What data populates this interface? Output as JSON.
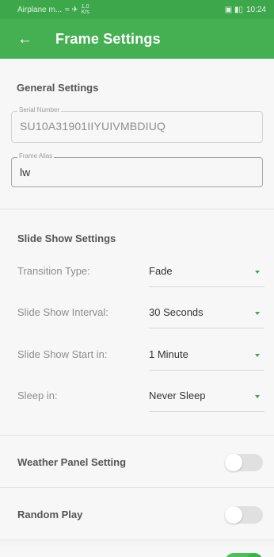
{
  "status_bar": {
    "carrier": "Airplane m...",
    "network_icons": "≈ ✈",
    "data_speed": "1.0\nK/s",
    "right_icons": "▣ ▮▯",
    "time": "10:24"
  },
  "app_bar": {
    "back_icon": "←",
    "title": "Frame Settings"
  },
  "general": {
    "title": "General Settings",
    "serial_label": "Serial Number",
    "serial_value": "SU10A31901IIYUIVMBDIUQ",
    "alias_label": "Frame Alias",
    "alias_value": "lw"
  },
  "slideshow": {
    "title": "Slide Show Settings",
    "rows": [
      {
        "label": "Transition Type:",
        "value": "Fade"
      },
      {
        "label": "Slide Show Interval:",
        "value": "30 Seconds"
      },
      {
        "label": "Slide Show Start in:",
        "value": "1 Minute"
      },
      {
        "label": "Sleep in:",
        "value": "Never Sleep"
      }
    ]
  },
  "toggles": [
    {
      "label": "Weather Panel Setting",
      "state": "off"
    },
    {
      "label": "Random Play",
      "state": "off"
    },
    {
      "label": "",
      "state": "on"
    }
  ],
  "colors": {
    "accent": "#45b052",
    "status_bar": "#3da74c",
    "toggle_on": "#4cc05a"
  }
}
